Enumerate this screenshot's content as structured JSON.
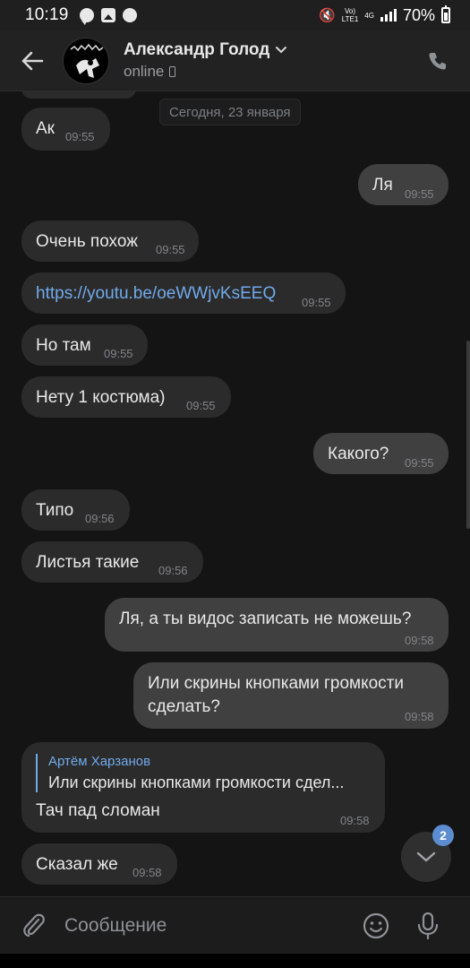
{
  "status_bar": {
    "time": "10:19",
    "network_top": "Vo)",
    "network_bottom": "LTE1",
    "network_type": "4G",
    "battery": "70%"
  },
  "header": {
    "contact_name": "Александр Голод",
    "status": "online",
    "back_icon": "arrow-left-icon",
    "call_icon": "phone-icon"
  },
  "date_separator": "Сегодня, 23 января",
  "messages": [
    {
      "text": "Ак",
      "time": "09:55",
      "direction": "in"
    },
    {
      "text": "Ля",
      "time": "09:55",
      "direction": "out"
    },
    {
      "text": "Очень похож",
      "time": "09:55",
      "direction": "in"
    },
    {
      "text": "https://youtu.be/oeWWjvKsEEQ",
      "time": "09:55",
      "direction": "in"
    },
    {
      "text": "Но там",
      "time": "09:55",
      "direction": "in"
    },
    {
      "text": "Нету 1 костюма)",
      "time": "09:55",
      "direction": "in"
    },
    {
      "text": "Какого?",
      "time": "09:55",
      "direction": "out"
    },
    {
      "text": "Типо",
      "time": "09:56",
      "direction": "in"
    },
    {
      "text": "Листья такие",
      "time": "09:56",
      "direction": "in"
    },
    {
      "text": "Ля, а ты видос записать не можешь?",
      "time": "09:58",
      "direction": "out"
    },
    {
      "text": "Или скрины кнопками громкости сделать?",
      "time": "09:58",
      "direction": "out"
    },
    {
      "text": "Тач пад сломан",
      "time": "09:58",
      "direction": "in",
      "reply_author": "Артём Харзанов",
      "reply_text": "Или скрины кнопками громкости сдел..."
    },
    {
      "text": "Сказал же",
      "time": "09:58",
      "direction": "in"
    }
  ],
  "scroll_down_badge": "2",
  "composer": {
    "placeholder": "Сообщение",
    "attach_icon": "paperclip-icon",
    "emoji_icon": "smile-icon",
    "mic_icon": "microphone-icon"
  },
  "colors": {
    "background": "#141414",
    "incoming_bubble": "#2b2b2b",
    "outgoing_bubble": "#404040",
    "link": "#71aaeb",
    "badge": "#5d8dd1"
  }
}
